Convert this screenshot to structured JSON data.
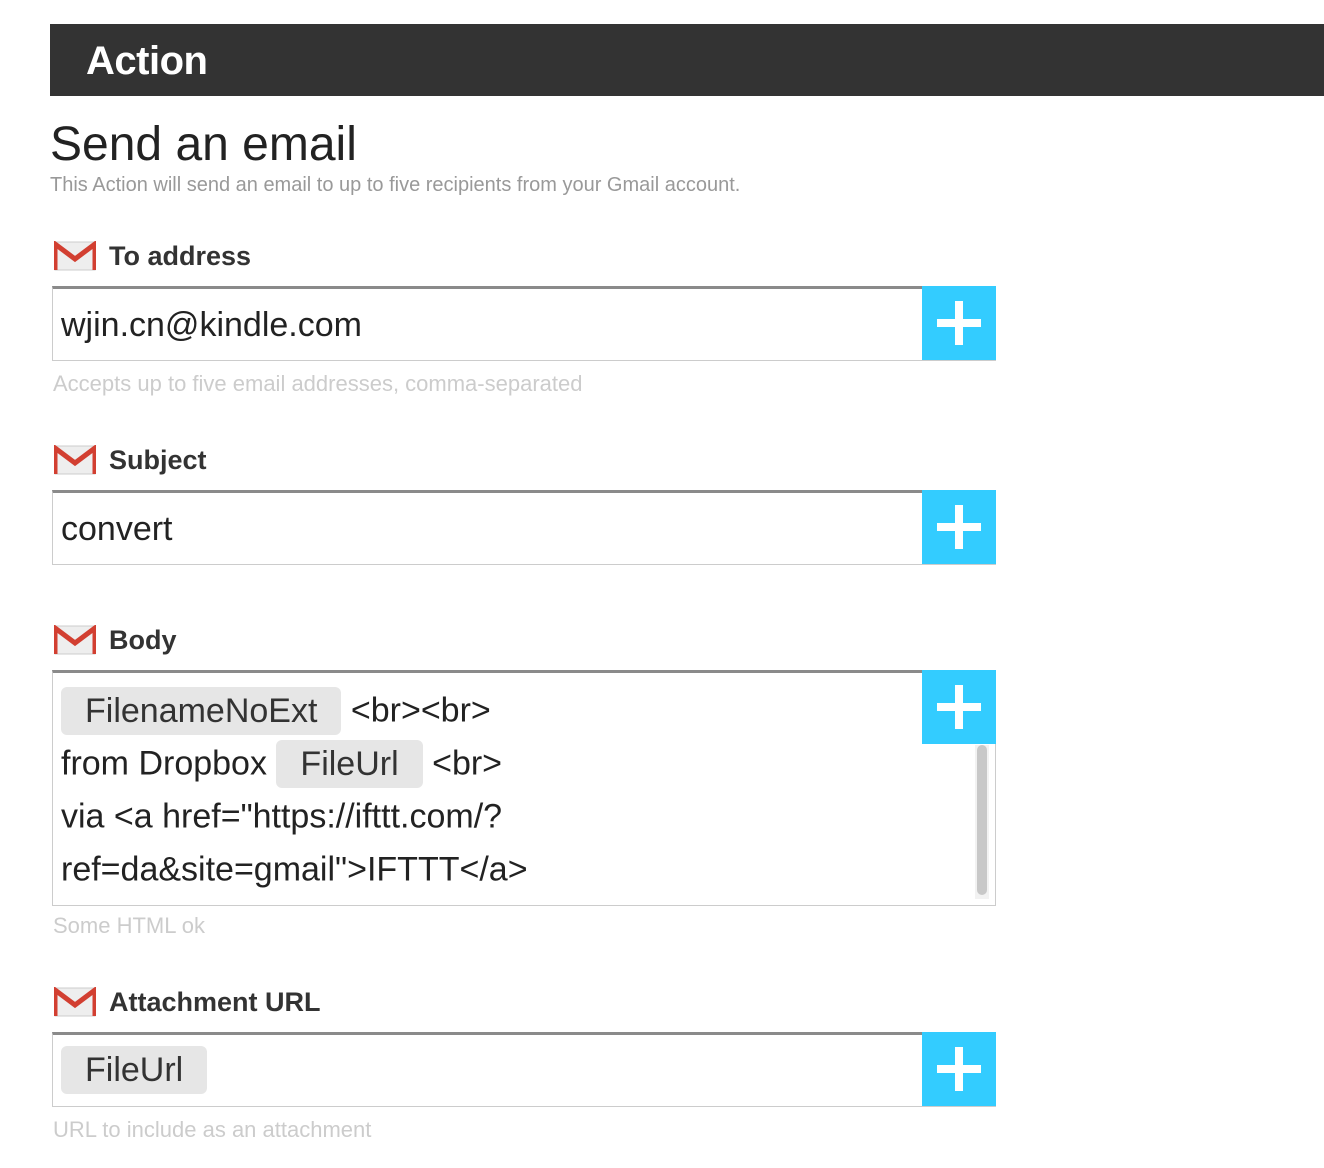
{
  "header": {
    "title": "Action"
  },
  "action": {
    "title": "Send an email",
    "description": "This Action will send an email to up to five recipients from your Gmail account."
  },
  "icons": {
    "field_icon": "gmail-icon",
    "add_ingredient_icon": "plus-icon"
  },
  "colors": {
    "header_bg": "#333333",
    "accent": "#33ccff",
    "helper_text": "#cccccc",
    "pill_bg": "#e6e6e6"
  },
  "fields": {
    "to_address": {
      "label": "To address",
      "value": "wjin.cn@kindle.com",
      "helper": "Accepts up to five email addresses, comma-separated"
    },
    "subject": {
      "label": "Subject",
      "value": "convert"
    },
    "body": {
      "label": "Body",
      "ingredient_1": "FilenameNoExt",
      "text_1": "<br><br>",
      "text_2": "from Dropbox",
      "ingredient_2": "FileUrl",
      "text_3": "<br>",
      "text_4": "via <a href=\"https://ifttt.com/?",
      "text_5": "ref=da&site=gmail\">IFTTT</a>",
      "helper": "Some HTML ok"
    },
    "attachment_url": {
      "label": "Attachment URL",
      "ingredient": "FileUrl",
      "helper": "URL to include as an attachment"
    }
  }
}
